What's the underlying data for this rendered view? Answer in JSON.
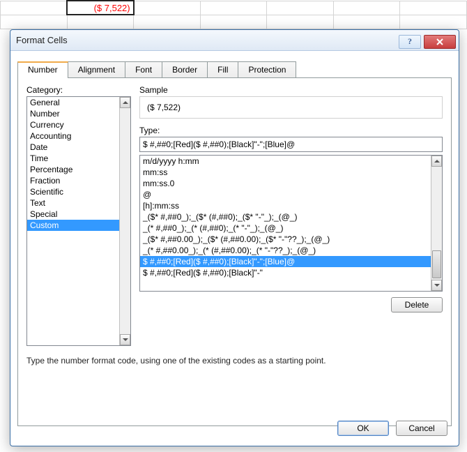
{
  "cell_value": "($ 7,522)",
  "dialog": {
    "title": "Format Cells",
    "tabs": [
      "Number",
      "Alignment",
      "Font",
      "Border",
      "Fill",
      "Protection"
    ],
    "active_tab": 0
  },
  "category_label": "Category:",
  "categories": [
    "General",
    "Number",
    "Currency",
    "Accounting",
    "Date",
    "Time",
    "Percentage",
    "Fraction",
    "Scientific",
    "Text",
    "Special",
    "Custom"
  ],
  "sample_label": "Sample",
  "sample_value": "($ 7,522)",
  "type_label": "Type:",
  "type_value": "$ #,##0;[Red]($ #,##0);[Black]\"-\";[Blue]@",
  "type_list": [
    "m/d/yyyy h:mm",
    "mm:ss",
    "mm:ss.0",
    "@",
    "[h]:mm:ss",
    "_($* #,##0_);_($* (#,##0);_($* \"-\"_);_(@_)",
    "_(* #,##0_);_(* (#,##0);_(* \"-\"_);_(@_)",
    "_($* #,##0.00_);_($* (#,##0.00);_($* \"-\"??_);_(@_)",
    "_(* #,##0.00_);_(* (#,##0.00);_(* \"-\"??_);_(@_)",
    "$ #,##0;[Red]($ #,##0);[Black]\"-\";[Blue]@",
    "$ #,##0;[Red]($ #,##0);[Black]\"-\""
  ],
  "type_selected_index": 9,
  "delete_label": "Delete",
  "hint_text": "Type the number format code, using one of the existing codes as a starting point.",
  "ok_label": "OK",
  "cancel_label": "Cancel"
}
